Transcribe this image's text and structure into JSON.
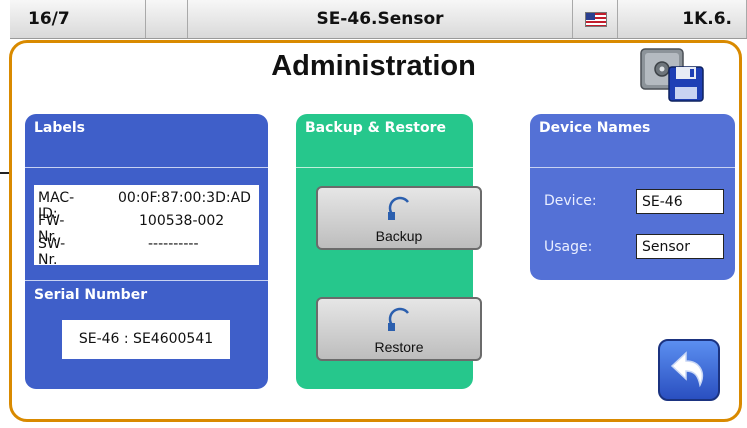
{
  "status_bar": {
    "date": "16/7",
    "device_title": "SE-46.Sensor",
    "language_flag_icon": "us-flag-icon",
    "code": "1K.6."
  },
  "page": {
    "title": "Administration"
  },
  "labels_panel": {
    "title": "Labels",
    "mac_label": "MAC-ID:",
    "mac_value": "00:0F:87:00:3D:AD",
    "fw_label": "FW-Nr.",
    "fw_value": "100538-002",
    "sw_label": "SW-Nr.",
    "sw_value": "----------",
    "serial_title": "Serial Number",
    "serial_value": "SE-46 : SE4600541"
  },
  "backup_panel": {
    "title": "Backup & Restore",
    "backup_label": "Backup",
    "restore_label": "Restore"
  },
  "names_panel": {
    "title": "Device Names",
    "device_label": "Device:",
    "device_value": "SE-46",
    "usage_label": "Usage:",
    "usage_value": "Sensor"
  },
  "colors": {
    "frame_border": "#d98a00",
    "labels_panel": "#3f5fc9",
    "backup_panel": "#26c78c",
    "names_panel": "#5471d6"
  }
}
